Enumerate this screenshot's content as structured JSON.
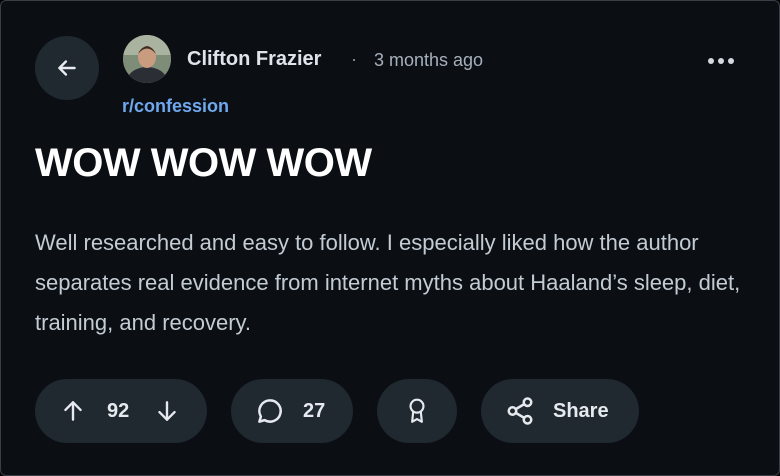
{
  "post": {
    "author": "Clifton Frazier",
    "separator": "·",
    "time": "3 months ago",
    "subreddit": "r/confession",
    "title": "WOW WOW WOW",
    "body": "Well researched and easy to follow. I especially liked how the author separates real evidence from internet myths about Haaland’s sleep, diet, training, and recovery."
  },
  "actions": {
    "score": "92",
    "comments": "27",
    "share_label": "Share"
  },
  "icons": {
    "back": "arrow-left-icon",
    "more": "ellipsis-icon",
    "upvote": "arrow-up-icon",
    "downvote": "arrow-down-icon",
    "comment": "chat-bubble-icon",
    "award": "award-ribbon-icon",
    "share": "share-nodes-icon"
  },
  "colors": {
    "background": "#0b0f14",
    "pill": "#202830",
    "subreddit_link": "#6fa8ee",
    "title": "#ffffff",
    "body_text": "#c3cbd3"
  }
}
